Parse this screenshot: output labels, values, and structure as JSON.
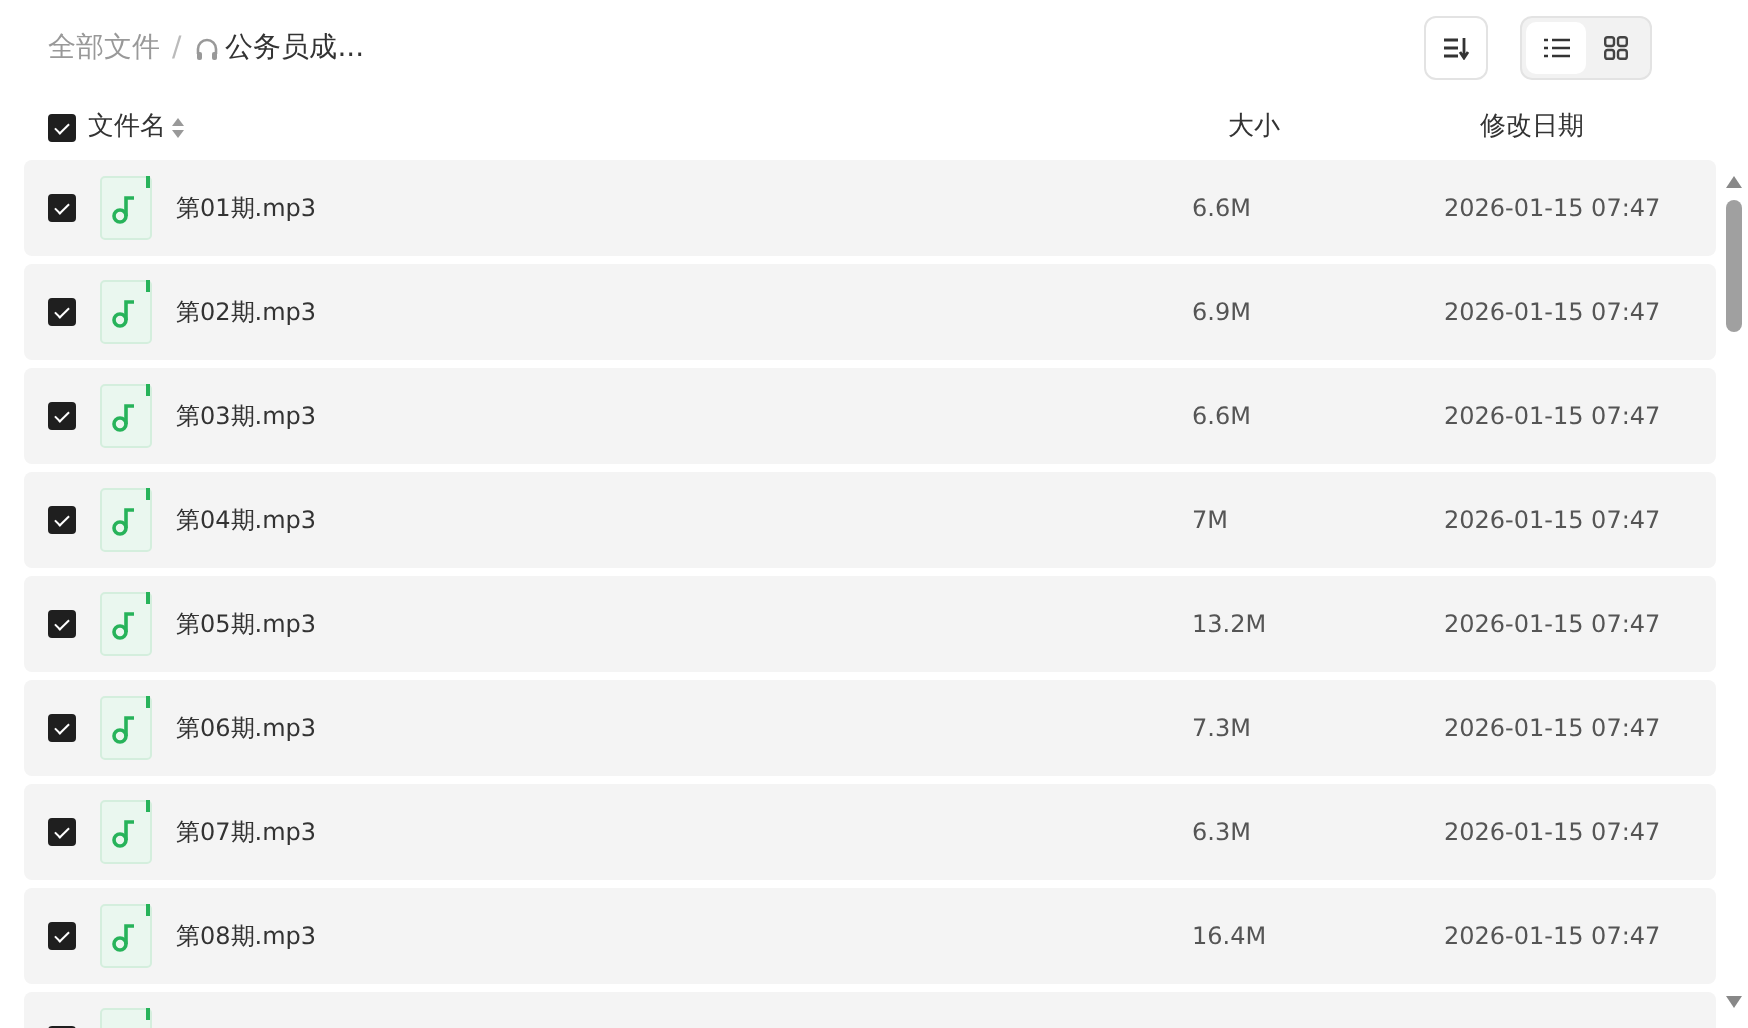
{
  "breadcrumb": [
    {
      "kind": "root",
      "label": "全部文件",
      "current": false
    },
    {
      "kind": "audio",
      "label": "公务员成...",
      "current": true
    }
  ],
  "breadcrumb_separator": "/",
  "view_modes": [
    {
      "kind": "list",
      "selected": true
    },
    {
      "kind": "grid",
      "selected": false
    }
  ],
  "header": {
    "checked": true,
    "columns": [
      "文件名",
      "大小",
      "修改日期"
    ]
  },
  "rows": [
    {
      "checked": true,
      "name": "第01期.mp3",
      "size": "6.6M",
      "date": "2026-01-15 07:47"
    },
    {
      "checked": true,
      "name": "第02期.mp3",
      "size": "6.9M",
      "date": "2026-01-15 07:47"
    },
    {
      "checked": true,
      "name": "第03期.mp3",
      "size": "6.6M",
      "date": "2026-01-15 07:47"
    },
    {
      "checked": true,
      "name": "第04期.mp3",
      "size": "7M",
      "date": "2026-01-15 07:47"
    },
    {
      "checked": true,
      "name": "第05期.mp3",
      "size": "13.2M",
      "date": "2026-01-15 07:47"
    },
    {
      "checked": true,
      "name": "第06期.mp3",
      "size": "7.3M",
      "date": "2026-01-15 07:47"
    },
    {
      "checked": true,
      "name": "第07期.mp3",
      "size": "6.3M",
      "date": "2026-01-15 07:47"
    },
    {
      "checked": true,
      "name": "第08期.mp3",
      "size": "16.4M",
      "date": "2026-01-15 07:47"
    },
    {
      "checked": true
    }
  ]
}
